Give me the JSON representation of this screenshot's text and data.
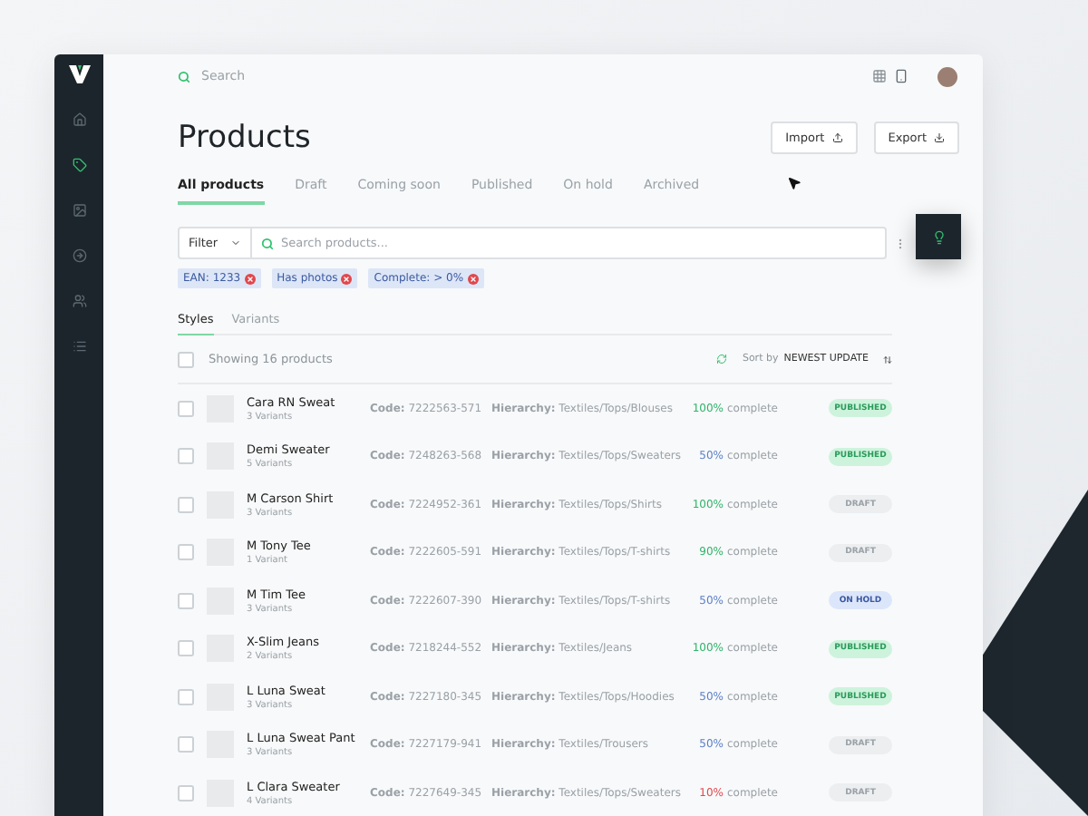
{
  "topbar": {
    "search_placeholder": "Search"
  },
  "page": {
    "title": "Products",
    "buttons": [
      {
        "label": "Import",
        "kind": "import"
      },
      {
        "label": "Export",
        "kind": "export"
      }
    ]
  },
  "tabs": [
    {
      "label": "All products",
      "selected": true
    },
    {
      "label": "Draft",
      "selected": false
    },
    {
      "label": "Coming soon",
      "selected": false
    },
    {
      "label": "Published",
      "selected": false
    },
    {
      "label": "On hold",
      "selected": false
    },
    {
      "label": "Archived",
      "selected": false
    }
  ],
  "filter": {
    "dropdown": "Filter",
    "placeholder": "Search products..."
  },
  "chips": [
    "EAN: 1233",
    "Has photos",
    "Complete: > 0%"
  ],
  "view_tabs": [
    {
      "label": "Styles",
      "selected": true
    },
    {
      "label": "Variants",
      "selected": false
    }
  ],
  "list_header": {
    "checked": false,
    "count": "Showing 16 products",
    "sort_label": "Sort by",
    "sort_value": "NEWEST UPDATE"
  },
  "sidebar": {
    "items": [
      {
        "kind": "home",
        "selected": false
      },
      {
        "kind": "tag",
        "selected": true
      },
      {
        "kind": "image",
        "selected": false
      },
      {
        "kind": "circle",
        "selected": false
      },
      {
        "kind": "users",
        "selected": false
      },
      {
        "kind": "list",
        "selected": false
      }
    ]
  },
  "products": [
    {
      "name": "Cara RN Sweat",
      "variants": "3 Variants",
      "code": "**Code:** 7222563-571",
      "hierarchy": "**Hierarchy:** Textiles/Tops/Blouses",
      "percent": "100%",
      "color": "#2fb36b",
      "complete": "complete",
      "status": "PUBLISHED",
      "kind": "published",
      "checked": false
    },
    {
      "name": "Demi Sweater",
      "variants": "5 Variants",
      "code": "**Code:** 7248263-568",
      "hierarchy": "**Hierarchy:** Textiles/Tops/Sweaters",
      "percent": "50%",
      "color": "#5b7fc7",
      "complete": "complete",
      "status": "PUBLISHED",
      "kind": "published",
      "checked": false
    },
    {
      "name": "M Carson Shirt",
      "variants": "3 Variants",
      "code": "**Code:** 7224952-361",
      "hierarchy": "**Hierarchy:** Textiles/Tops/Shirts",
      "percent": "100%",
      "color": "#2fb36b",
      "complete": "complete",
      "status": "DRAFT",
      "kind": "draft",
      "checked": false
    },
    {
      "name": "M Tony Tee",
      "variants": "1 Variant",
      "code": "**Code:** 7222605-591",
      "hierarchy": "**Hierarchy:** Textiles/Tops/T-shirts",
      "percent": "90%",
      "color": "#2fb36b",
      "complete": "complete",
      "status": "DRAFT",
      "kind": "draft",
      "checked": false
    },
    {
      "name": "M Tim Tee",
      "variants": "3 Variants",
      "code": "**Code:** 7222607-390",
      "hierarchy": "**Hierarchy:** Textiles/Tops/T-shirts",
      "percent": "50%",
      "color": "#5b7fc7",
      "complete": "complete",
      "status": "ON HOLD",
      "kind": "on_hold",
      "checked": false
    },
    {
      "name": "X-Slim Jeans",
      "variants": "2 Variants",
      "code": "**Code:** 7218244-552",
      "hierarchy": "**Hierarchy:** Textiles/Jeans",
      "percent": "100%",
      "color": "#2fb36b",
      "complete": "complete",
      "status": "PUBLISHED",
      "kind": "published",
      "checked": false
    },
    {
      "name": "L Luna Sweat",
      "variants": "3 Variants",
      "code": "**Code:** 7227180-345",
      "hierarchy": "**Hierarchy:** Textiles/Tops/Hoodies",
      "percent": "50%",
      "color": "#5b7fc7",
      "complete": "complete",
      "status": "PUBLISHED",
      "kind": "published",
      "checked": false
    },
    {
      "name": "L Luna Sweat Pant",
      "variants": "3 Variants",
      "code": "**Code:** 7227179-941",
      "hierarchy": "**Hierarchy:** Textiles/Trousers",
      "percent": "50%",
      "color": "#5b7fc7",
      "complete": "complete",
      "status": "DRAFT",
      "kind": "draft",
      "checked": false
    },
    {
      "name": "L Clara Sweater",
      "variants": "4 Variants",
      "code": "**Code:** 7227649-345",
      "hierarchy": "**Hierarchy:** Textiles/Tops/Sweaters",
      "percent": "10%",
      "color": "#e0474c",
      "complete": "complete",
      "status": "DRAFT",
      "kind": "draft",
      "checked": false
    }
  ]
}
